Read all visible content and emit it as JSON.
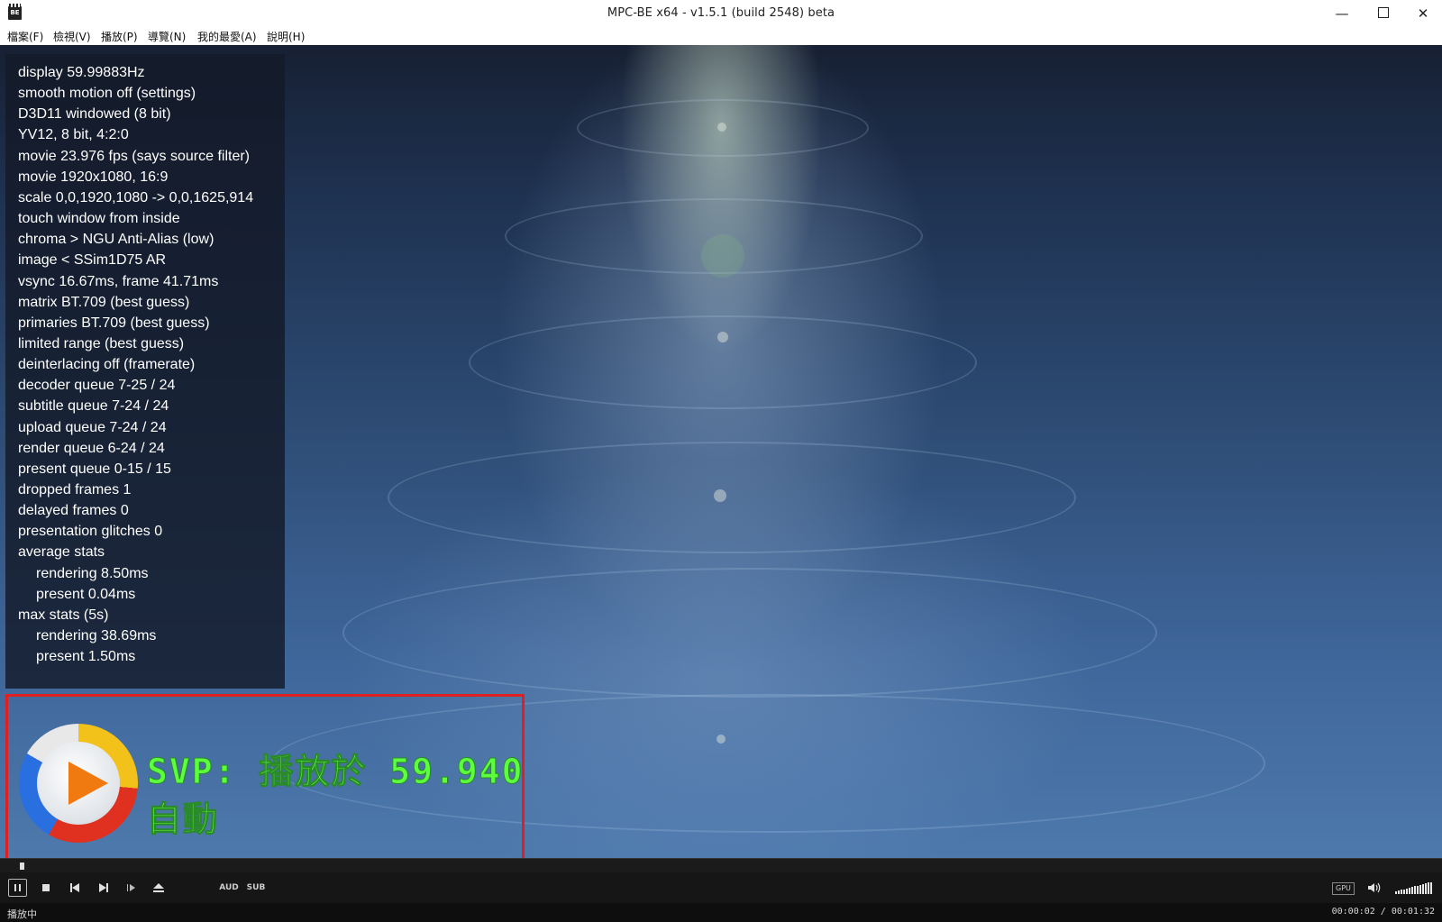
{
  "window": {
    "title": "MPC-BE x64 - v1.5.1 (build 2548) beta",
    "app_icon_label": "BE",
    "minimize_glyph": "—",
    "close_glyph": "✕"
  },
  "menu": [
    {
      "label": "檔案(F)"
    },
    {
      "label": "檢視(V)"
    },
    {
      "label": "播放(P)"
    },
    {
      "label": "導覽(N)"
    },
    {
      "label": "我的最愛(A)"
    },
    {
      "label": "說明(H)"
    }
  ],
  "stats": {
    "lines": [
      "display 59.99883Hz",
      "smooth motion off (settings)",
      "D3D11 windowed (8 bit)",
      "YV12, 8 bit, 4:2:0",
      "movie 23.976 fps  (says source filter)",
      "movie 1920x1080, 16:9",
      "scale 0,0,1920,1080 -> 0,0,1625,914",
      "touch window from inside",
      "chroma > NGU Anti-Alias (low)",
      "image < SSim1D75 AR",
      "vsync 16.67ms, frame 41.71ms",
      "matrix BT.709 (best guess)",
      "primaries BT.709 (best guess)",
      "limited range (best guess)",
      "deinterlacing off (framerate)",
      "decoder queue 7-25 / 24",
      "subtitle queue 7-24 / 24",
      "upload queue 7-24 / 24",
      "render queue 6-24 / 24",
      "present queue 0-15 / 15",
      "dropped frames 1",
      "delayed frames 0",
      "presentation glitches 0",
      "average stats",
      "rendering 8.50ms",
      "present 0.04ms",
      "max stats (5s)",
      "rendering 38.69ms",
      "present 1.50ms"
    ]
  },
  "svp": {
    "line1": "SVP: 播放於 59.940",
    "line2": "自動"
  },
  "controls": {
    "aud_label": "AUD",
    "sub_label": "SUB",
    "gpu_label": "GPU",
    "volume_level": 1.0
  },
  "status": {
    "state": "播放中",
    "time": "00:00:02 / 00:01:32"
  },
  "seek": {
    "position_fraction": 0.022
  }
}
